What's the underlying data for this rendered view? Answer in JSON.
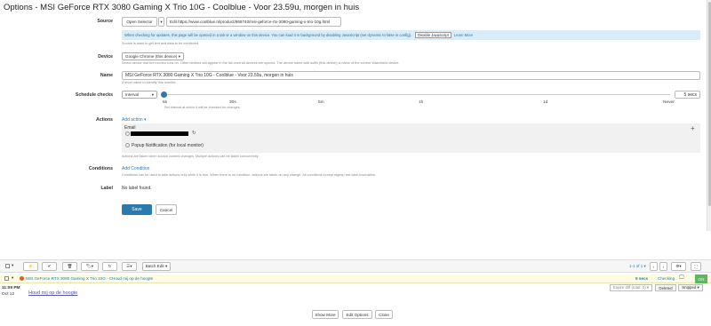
{
  "page_title": "Options - MSI GeForce RTX 3080 Gaming X Trio 10G - Coolblue - Voor 23.59u, morgen in huis",
  "source": {
    "label": "Source",
    "selector_button": "Open Selector",
    "dropdown_arrow": "▾",
    "url_button": "Edit https://www.coolblue.nl/product/868740/msi-geforce-rtx-3080-gaming-x-trio-10g.html",
    "info_text": "When checking for updates, this page will be opened in a tab or a window on this device. You can load it in background by disabling JavaScript (set dynamic to false in config).",
    "disable_js_button": "Disable JavaScript",
    "learn_more_link": "Learn More",
    "help": "Source is used to get text and data to be monitored."
  },
  "device": {
    "label": "Device",
    "selected": "Google Chrome (this device)",
    "help": "Select device that the monitor runs on. Other devices will appear in the list once all devices are synced. The device name with suffix (this device) is name of the current Watchlist's device."
  },
  "name": {
    "label": "Name",
    "value": "MSI GeForce RTX 3080 Gaming X Trio 10G - Coolblue - Voor 23.59u, morgen in huis",
    "help": "A short name to identify this monitor."
  },
  "schedule": {
    "label": "Schedule checks",
    "selected": "Interval",
    "value_text": "5 secs",
    "ticks": [
      "5s",
      "30s",
      "5m",
      "1h",
      "1d",
      "Never"
    ],
    "slider_position": 0.0,
    "help": "Set interval at which it will be checked for changes."
  },
  "actions": {
    "label": "Actions",
    "add_action_link": "Add action ▾",
    "email_label": "Email",
    "refresh_glyph": "↻",
    "plus_glyph": "+",
    "popup_text": "Popup Notification (for local monitor)",
    "help": "Actions are taken when source content changes. Multiple actions can be taken concurrently."
  },
  "conditions": {
    "label": "Conditions",
    "add_condition_link": "Add Condition",
    "help": "Conditions can be used to take actions only while it is true. When there is no condition, actions are taken on any change. All conditions except regexp are case-insensitive."
  },
  "label_field": {
    "label": "Label",
    "value": "No label found."
  },
  "buttons": {
    "save": "Save",
    "cancel": "Cancel"
  },
  "toolbar": {
    "batch_edit": "Batch Edit ▾",
    "pagination": "1-1 of 1 ▾",
    "prev": "‹",
    "next": "›"
  },
  "list_row": {
    "title": "MSI GeForce RTX 3080 Gaming X Trio 10G - C",
    "subtitle": "Houd mij op de hoogte",
    "interval": "5 secs",
    "status": "Checking",
    "toggle": "ON"
  },
  "detail": {
    "time": "11:09 PM",
    "date": "Oct 12",
    "content": "Houd mij op de hoogte",
    "expire_field": "Expire diff (total: 0) ▾",
    "deleted_button": "Deleted",
    "snipped_button": "Snipped ▾",
    "show_more": "Show More",
    "edit_options": "Edit Options",
    "close": "Close"
  },
  "colors": {
    "accent": "#2a7ab0",
    "info_bg": "#d9ecf8",
    "row_bg": "#fdfbe0",
    "on_green": "#5cb85c"
  }
}
